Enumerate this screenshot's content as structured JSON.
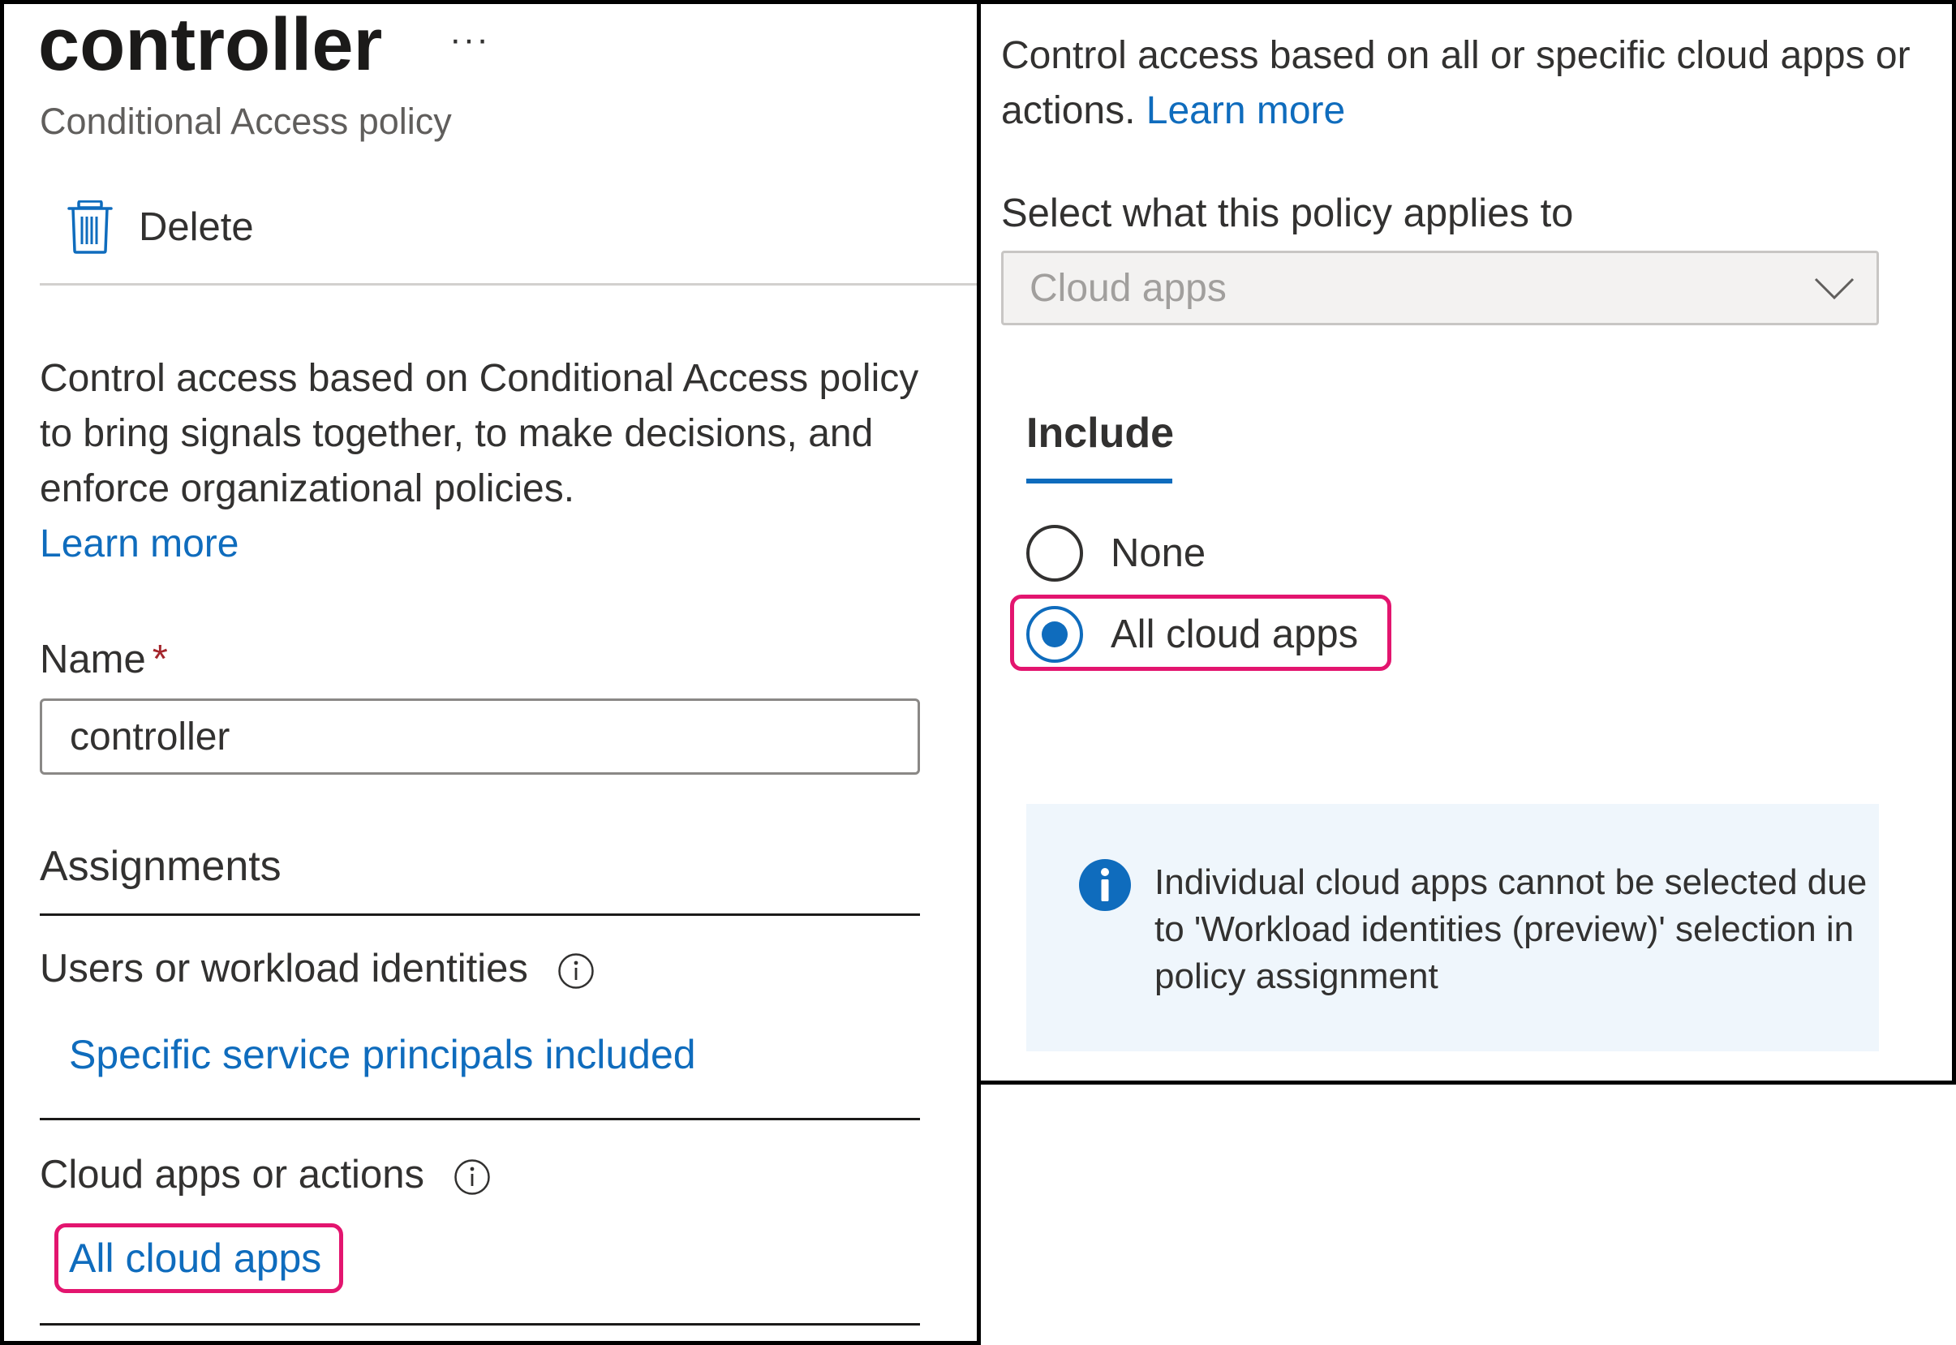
{
  "left_panel": {
    "title": "controller",
    "more_menu_label": "···",
    "subtitle": "Conditional Access policy",
    "toolbar": {
      "delete_label": "Delete",
      "delete_icon": "trash-icon"
    },
    "description": "Control access based on Conditional Access policy to bring signals together, to make decisions, and enforce organizational policies.",
    "learn_more": "Learn more",
    "name_field": {
      "label": "Name",
      "required_marker": "*",
      "value": "controller"
    },
    "assignments_heading": "Assignments",
    "users": {
      "label": "Users or workload identities",
      "value": "Specific service principals included",
      "info_icon": "info-outline-icon"
    },
    "cloud_apps": {
      "label": "Cloud apps or actions",
      "value": "All cloud apps",
      "info_icon": "info-outline-icon"
    }
  },
  "right_panel": {
    "description": "Control access based on all or specific cloud apps or actions.",
    "learn_more": "Learn more",
    "applies_label": "Select what this policy applies to",
    "applies_value": "Cloud apps",
    "include_tab": "Include",
    "radio_options": [
      {
        "label": "None",
        "selected": false
      },
      {
        "label": "All cloud apps",
        "selected": true
      }
    ],
    "info_message": "Individual cloud apps cannot be selected due to 'Workload identities (preview)' selection in policy assignment"
  },
  "colors": {
    "accent": "#0f6cbd",
    "highlight": "#e3156f",
    "required": "#a4262c",
    "info_background": "#eff6fc"
  }
}
